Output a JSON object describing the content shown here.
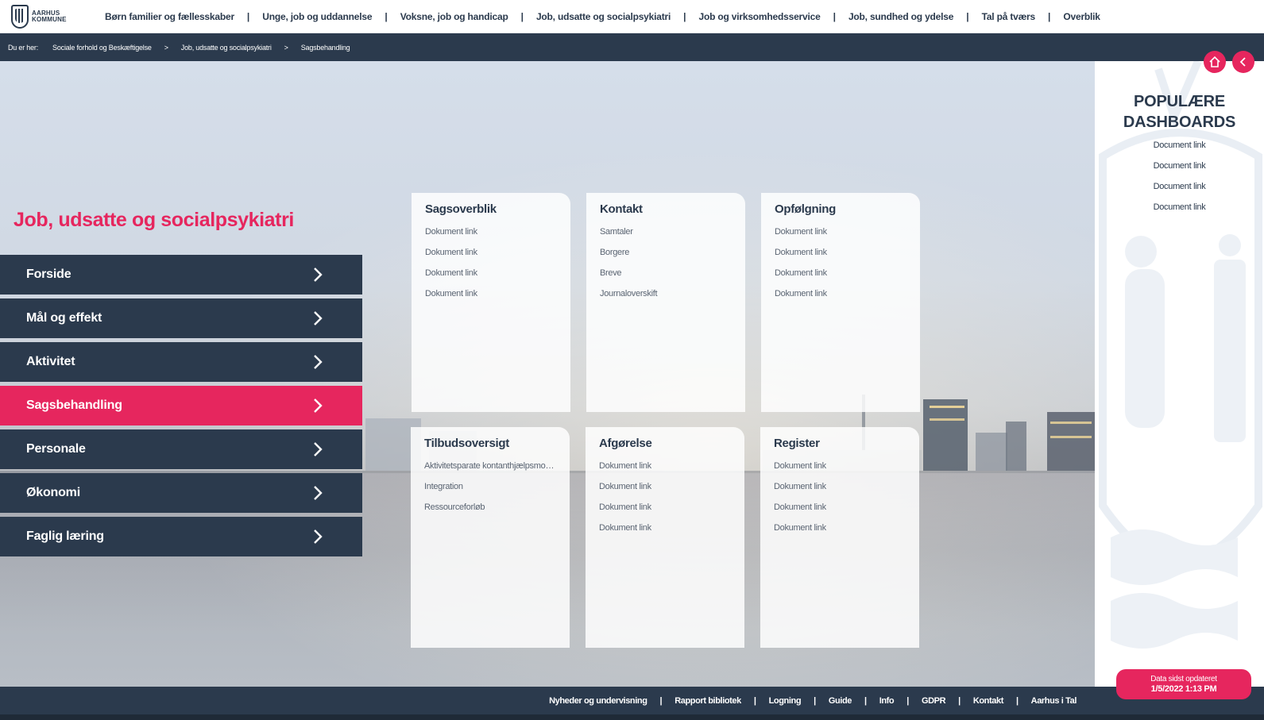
{
  "logo": {
    "line1": "AARHUS",
    "line2": "KOMMUNE"
  },
  "nav": {
    "items": [
      "Børn familier og fællesskaber",
      "Unge, job og uddannelse",
      "Voksne, job og handicap",
      "Job, udsatte og socialpsykiatri",
      "Job og virksomhedsservice",
      "Job, sundhed og ydelse",
      "Tal på tværs",
      "Overblik"
    ],
    "separator": "|"
  },
  "breadcrumb": {
    "lead": "Du er her:",
    "items": [
      "Sociale forhold og Beskæftigelse",
      "Job, udsatte og socialpsykiatri",
      "Sagsbehandling"
    ],
    "separator": ">"
  },
  "page": {
    "title": "Job, udsatte og socialpsykiatri"
  },
  "menu": {
    "items": [
      "Forside",
      "Mål og effekt",
      "Aktivitet",
      "Sagsbehandling",
      "Personale",
      "Økonomi",
      "Faglig læring"
    ],
    "active": "Sagsbehandling"
  },
  "cards": [
    {
      "title": "Sagsoverblik",
      "links": [
        "Dokument link",
        "Dokument link",
        "Dokument link",
        "Dokument link"
      ]
    },
    {
      "title": "Kontakt",
      "links": [
        "Samtaler",
        "Borgere",
        "Breve",
        "Journaloverskift"
      ]
    },
    {
      "title": "Opfølgning",
      "links": [
        "Dokument link",
        "Dokument link",
        "Dokument link",
        "Dokument link"
      ]
    },
    {
      "title": "Tilbudsoversigt",
      "links": [
        "Aktivitetsparate kontanthjælpsmodt...",
        "Integration",
        "Ressourceforløb"
      ]
    },
    {
      "title": "Afgørelse",
      "links": [
        "Dokument link",
        "Dokument link",
        "Dokument link",
        "Dokument link"
      ]
    },
    {
      "title": "Register",
      "links": [
        "Dokument link",
        "Dokument link",
        "Dokument link",
        "Dokument link"
      ]
    }
  ],
  "sidebar": {
    "title_line1": "POPULÆRE",
    "title_line2": "DASHBOARDS",
    "links": [
      "Document link",
      "Document link",
      "Document link",
      "Document link"
    ]
  },
  "footer": {
    "links": [
      "Nyheder og undervisning",
      "Rapport bibliotek",
      "Logning",
      "Guide",
      "Info",
      "GDPR",
      "Kontakt",
      "Aarhus i Tal"
    ],
    "separator": "|"
  },
  "updated": {
    "line1": "Data sidst opdateret",
    "line2": "1/5/2022 1:13 PM"
  },
  "colors": {
    "navy": "#2b3a4d",
    "pink": "#e6265e",
    "white": "#ffffff"
  },
  "icons": {
    "home": "home-icon",
    "back": "chevron-left-icon",
    "menu_arrow": "chevron-right-icon"
  }
}
